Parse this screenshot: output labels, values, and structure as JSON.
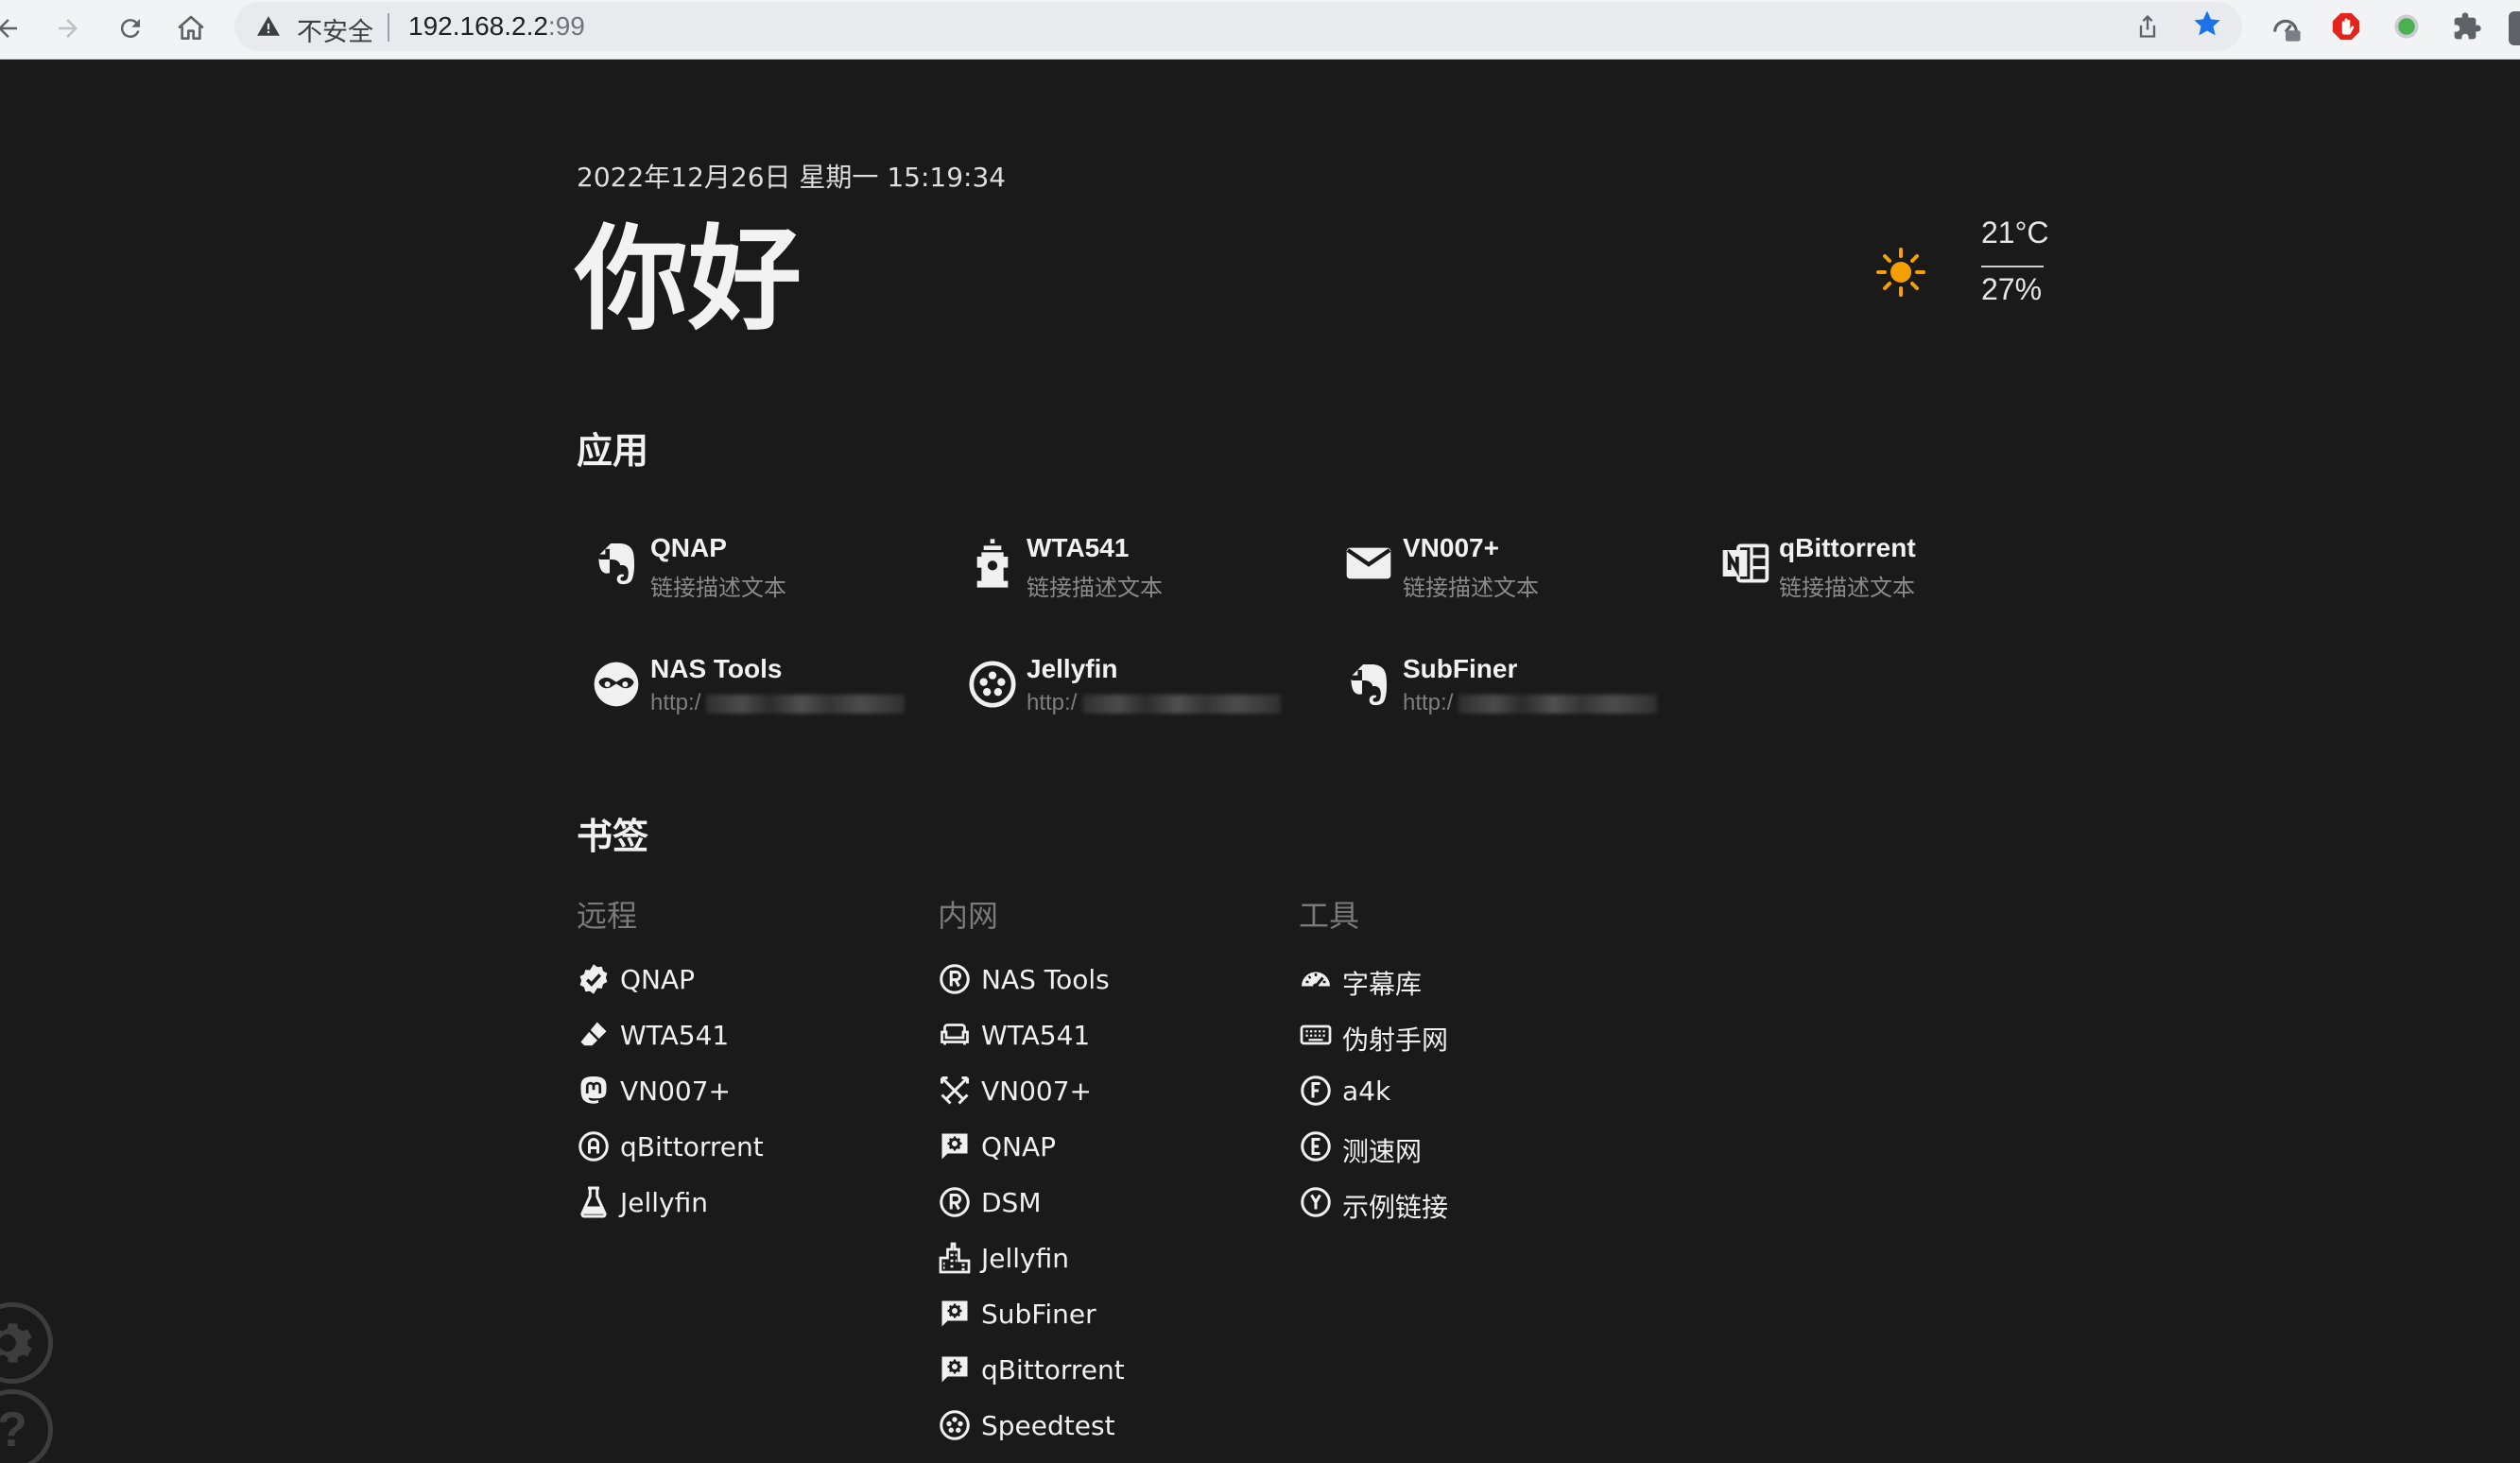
{
  "browser": {
    "security_label": "不安全",
    "url_host": "192.168.2.2",
    "url_port": ":99"
  },
  "header": {
    "datetime": "2022年12月26日 星期一 15:19:34",
    "greeting": "你好"
  },
  "weather": {
    "icon": "sun-icon",
    "temperature": "21°C",
    "humidity": "27%",
    "accent_color": "#f5a000"
  },
  "apps": {
    "title": "应用",
    "items": [
      {
        "name": "QNAP",
        "desc": "链接描述文本",
        "icon": "evernote-icon"
      },
      {
        "name": "WTA541",
        "desc": "链接描述文本",
        "icon": "fire-hydrant-icon"
      },
      {
        "name": "VN007+",
        "desc": "链接描述文本",
        "icon": "mail-icon"
      },
      {
        "name": "qBittorrent",
        "desc": "链接描述文本",
        "icon": "onenote-icon"
      },
      {
        "name": "NAS Tools",
        "desc": "http:/",
        "icon": "mask-icon"
      },
      {
        "name": "Jellyfin",
        "desc": "http:/",
        "icon": "face-icon"
      },
      {
        "name": "SubFiner",
        "desc": "http:/",
        "icon": "evernote-icon"
      }
    ]
  },
  "bookmarks": {
    "title": "书签",
    "groups": [
      {
        "title": "远程",
        "items": [
          {
            "label": "QNAP",
            "icon": "check-decagram-icon"
          },
          {
            "label": "WTA541",
            "icon": "eraser-icon"
          },
          {
            "label": "VN007+",
            "icon": "mastodon-icon"
          },
          {
            "label": "qBittorrent",
            "icon": "alpha-a-circle-icon"
          },
          {
            "label": "Jellyfin",
            "icon": "flask-icon"
          }
        ]
      },
      {
        "title": "内网",
        "items": [
          {
            "label": "NAS Tools",
            "icon": "registered-icon"
          },
          {
            "label": "WTA541",
            "icon": "sofa-icon"
          },
          {
            "label": "VN007+",
            "icon": "sword-cross-icon"
          },
          {
            "label": "QNAP",
            "icon": "message-cog-icon"
          },
          {
            "label": "DSM",
            "icon": "registered-icon"
          },
          {
            "label": "Jellyfin",
            "icon": "city-icon"
          },
          {
            "label": "SubFiner",
            "icon": "message-cog-icon"
          },
          {
            "label": "qBittorrent",
            "icon": "message-cog-icon"
          },
          {
            "label": "Speedtest",
            "icon": "face-icon"
          }
        ]
      },
      {
        "title": "工具",
        "items": [
          {
            "label": "字幕库",
            "icon": "speedometer-icon"
          },
          {
            "label": "伪射手网",
            "icon": "keyboard-icon"
          },
          {
            "label": "a4k",
            "icon": "alpha-f-circle-icon"
          },
          {
            "label": "测速网",
            "icon": "alpha-e-circle-icon"
          },
          {
            "label": "示例链接",
            "icon": "alpha-y-circle-icon"
          }
        ]
      }
    ]
  },
  "corner": {
    "settings_icon": "gear-icon",
    "help_icon": "help-icon",
    "help_glyph": "?"
  }
}
